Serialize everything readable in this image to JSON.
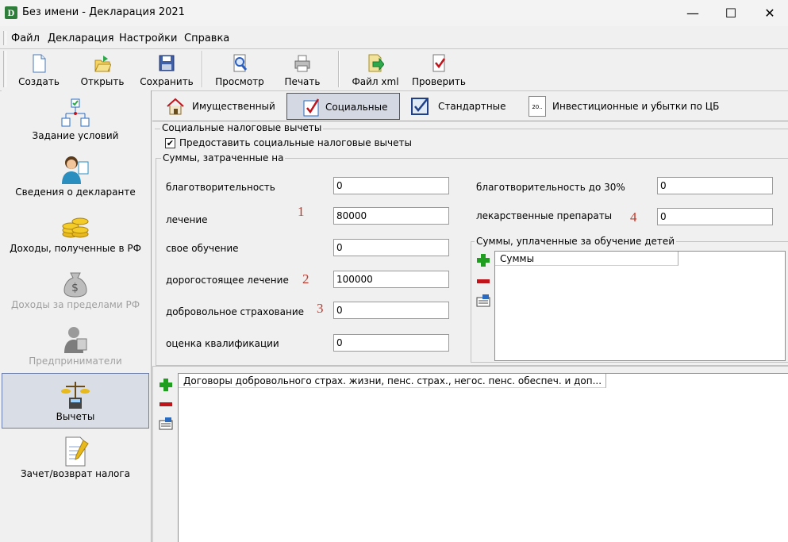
{
  "window": {
    "title": "Без имени - Декларация 2021",
    "app_icon_letter": "D",
    "controls": {
      "minimize": "—",
      "maximize": "☐",
      "close": "✕"
    }
  },
  "menu": [
    "Файл",
    "Декларация",
    "Настройки",
    "Справка"
  ],
  "toolbar": {
    "create": "Создать",
    "open": "Открыть",
    "save": "Сохранить",
    "preview": "Просмотр",
    "print": "Печать",
    "xml": "Файл xml",
    "check": "Проверить"
  },
  "nav": {
    "conditions": "Задание условий",
    "declarant": "Сведения о декларанте",
    "income_rf": "Доходы, полученные в РФ",
    "income_abroad": "Доходы за пределами РФ",
    "entrepreneurs": "Предприниматели",
    "deductions": "Вычеты",
    "refund": "Зачет/возврат налога"
  },
  "tabs": {
    "property": "Имущественный",
    "social": "Социальные",
    "standard": "Стандартные",
    "investment": "Инвестиционные и убытки по ЦБ",
    "investment_icon_text": "20.."
  },
  "social": {
    "group_title": "Социальные налоговые вычеты",
    "checkbox_label": "Предоставить социальные налоговые вычеты",
    "checkbox_checked": true,
    "sums_title": "Суммы, затраченные на",
    "fields": {
      "charity": {
        "label": "благотворительность",
        "value": "0"
      },
      "treatment": {
        "label": "лечение",
        "value": "80000"
      },
      "education": {
        "label": "свое обучение",
        "value": "0"
      },
      "expensive_treatment": {
        "label": "дорогостоящее лечение",
        "value": "100000"
      },
      "voluntary_insurance": {
        "label": "добровольное страхование",
        "value": "0"
      },
      "qualification": {
        "label": "оценка квалификации",
        "value": "0"
      },
      "charity_30": {
        "label": "благотворительность до 30%",
        "value": "0"
      },
      "medicines": {
        "label": "лекарственные препараты",
        "value": "0"
      }
    },
    "annotations": [
      "1",
      "2",
      "3",
      "4"
    ],
    "children_edu": {
      "title": "Суммы, уплаченные за обучение детей",
      "column": "Суммы"
    },
    "contracts": {
      "column": "Договоры добровольного страх. жизни, пенс. страх., негос. пенс. обеспеч. и доп..."
    }
  },
  "colors": {
    "add": "#1f9e1f",
    "remove": "#c0141b",
    "annotation": "#c0392b",
    "active_bg": "#d9dde6"
  }
}
